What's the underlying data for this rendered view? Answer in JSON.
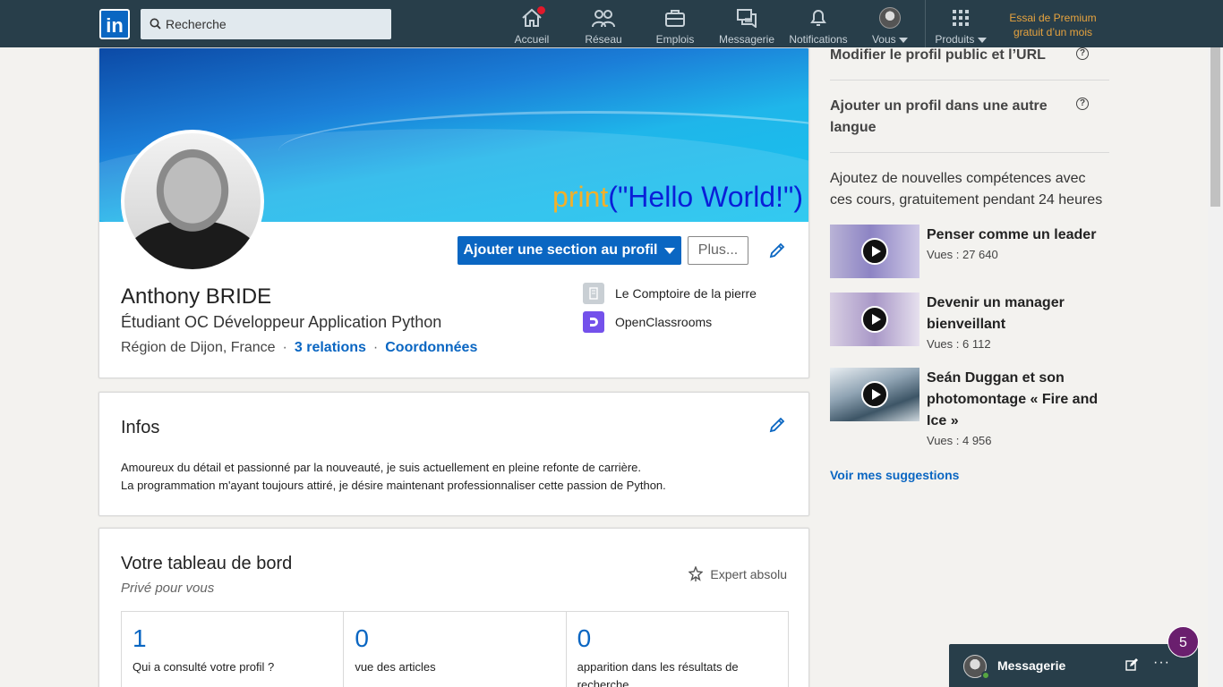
{
  "nav": {
    "logo": "in",
    "search_placeholder": "Recherche",
    "items": [
      {
        "label": "Accueil",
        "icon": "home-icon"
      },
      {
        "label": "Réseau",
        "icon": "network-icon"
      },
      {
        "label": "Emplois",
        "icon": "briefcase-icon"
      },
      {
        "label": "Messagerie",
        "icon": "messages-icon"
      },
      {
        "label": "Notifications",
        "icon": "bell-icon"
      },
      {
        "label": "Vous",
        "icon": "avatar"
      },
      {
        "label": "Produits",
        "icon": "grid-icon"
      }
    ],
    "premium": "Essai de Premium gratuit d’un mois"
  },
  "profile": {
    "banner_keyword": "print",
    "banner_rest": "(\"Hello World!\")",
    "name": "Anthony BRIDE",
    "headline": "Étudiant OC Développeur Application Python",
    "location": "Région de Dijon, France",
    "relations": "3 relations",
    "contact": "Coordonnées",
    "add_section_button": "Ajouter une section au profil",
    "more_button": "Plus...",
    "experience": [
      {
        "label": "Le Comptoire de la pierre"
      },
      {
        "label": "OpenClassrooms"
      }
    ]
  },
  "infos": {
    "title": "Infos",
    "line1": "Amoureux du détail et passionné par la nouveauté, je suis actuellement en pleine refonte de carrière.",
    "line2": "La programmation m'ayant toujours attiré, je désire maintenant professionnaliser cette passion de Python."
  },
  "dashboard": {
    "title": "Votre tableau de bord",
    "subtitle": "Privé pour vous",
    "expert": "Expert absolu",
    "stats": [
      {
        "num": "1",
        "desc": "Qui a consulté votre profil ?"
      },
      {
        "num": "0",
        "desc": "vue des articles"
      },
      {
        "num": "0",
        "desc": "apparition dans les résultats de recherche"
      }
    ]
  },
  "rail": {
    "public_profile": "Modifier le profil public et l’URL",
    "other_language": "Ajouter un profil dans une autre langue",
    "intro": "Ajoutez de nouvelles compétences avec ces cours, gratuitement pendant 24 heures",
    "courses": [
      {
        "title": "Penser comme un leader",
        "views": "Vues : 27 640"
      },
      {
        "title": "Devenir un manager bienveillant",
        "views": "Vues : 6 112"
      },
      {
        "title": "Seán Duggan et son photomontage « Fire and Ice »",
        "views": "Vues : 4 956"
      }
    ],
    "suggestions": "Voir mes suggestions"
  },
  "messaging": {
    "label": "Messagerie",
    "count": "5"
  },
  "colors": {
    "nav_bg": "#283e4a",
    "brand": "#0a66c2",
    "premium": "#e7a33e",
    "badge": "#6a1f6e"
  }
}
